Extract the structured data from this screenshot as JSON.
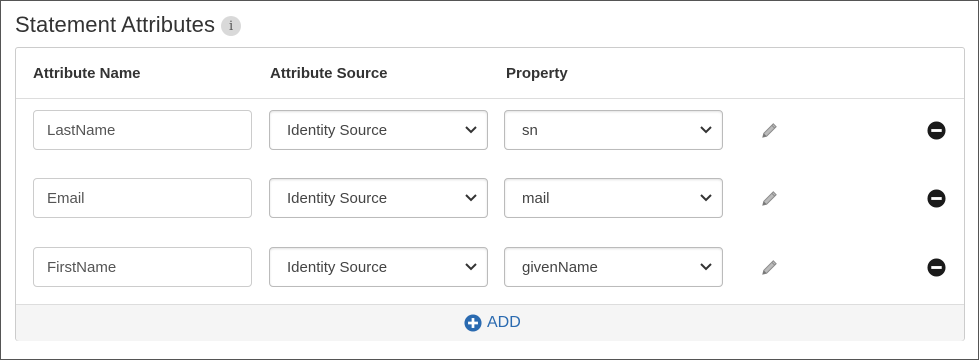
{
  "section": {
    "title": "Statement Attributes",
    "info_glyph": "i"
  },
  "table": {
    "headers": {
      "attribute_name": "Attribute Name",
      "attribute_source": "Attribute Source",
      "property": "Property"
    },
    "rows": [
      {
        "attribute_name": "LastName",
        "attribute_source": "Identity Source",
        "property": "sn"
      },
      {
        "attribute_name": "Email",
        "attribute_source": "Identity Source",
        "property": "mail"
      },
      {
        "attribute_name": "FirstName",
        "attribute_source": "Identity Source",
        "property": "givenName"
      }
    ],
    "add_label": "ADD"
  },
  "icons": {
    "info": "info-icon",
    "edit": "pencil-icon",
    "remove": "minus-circle-icon",
    "add": "plus-circle-icon",
    "dropdown": "chevron-down-icon"
  },
  "colors": {
    "accent": "#2a6ab0",
    "remove_icon": "#1a1a1a",
    "edit_icon": "#999999"
  }
}
